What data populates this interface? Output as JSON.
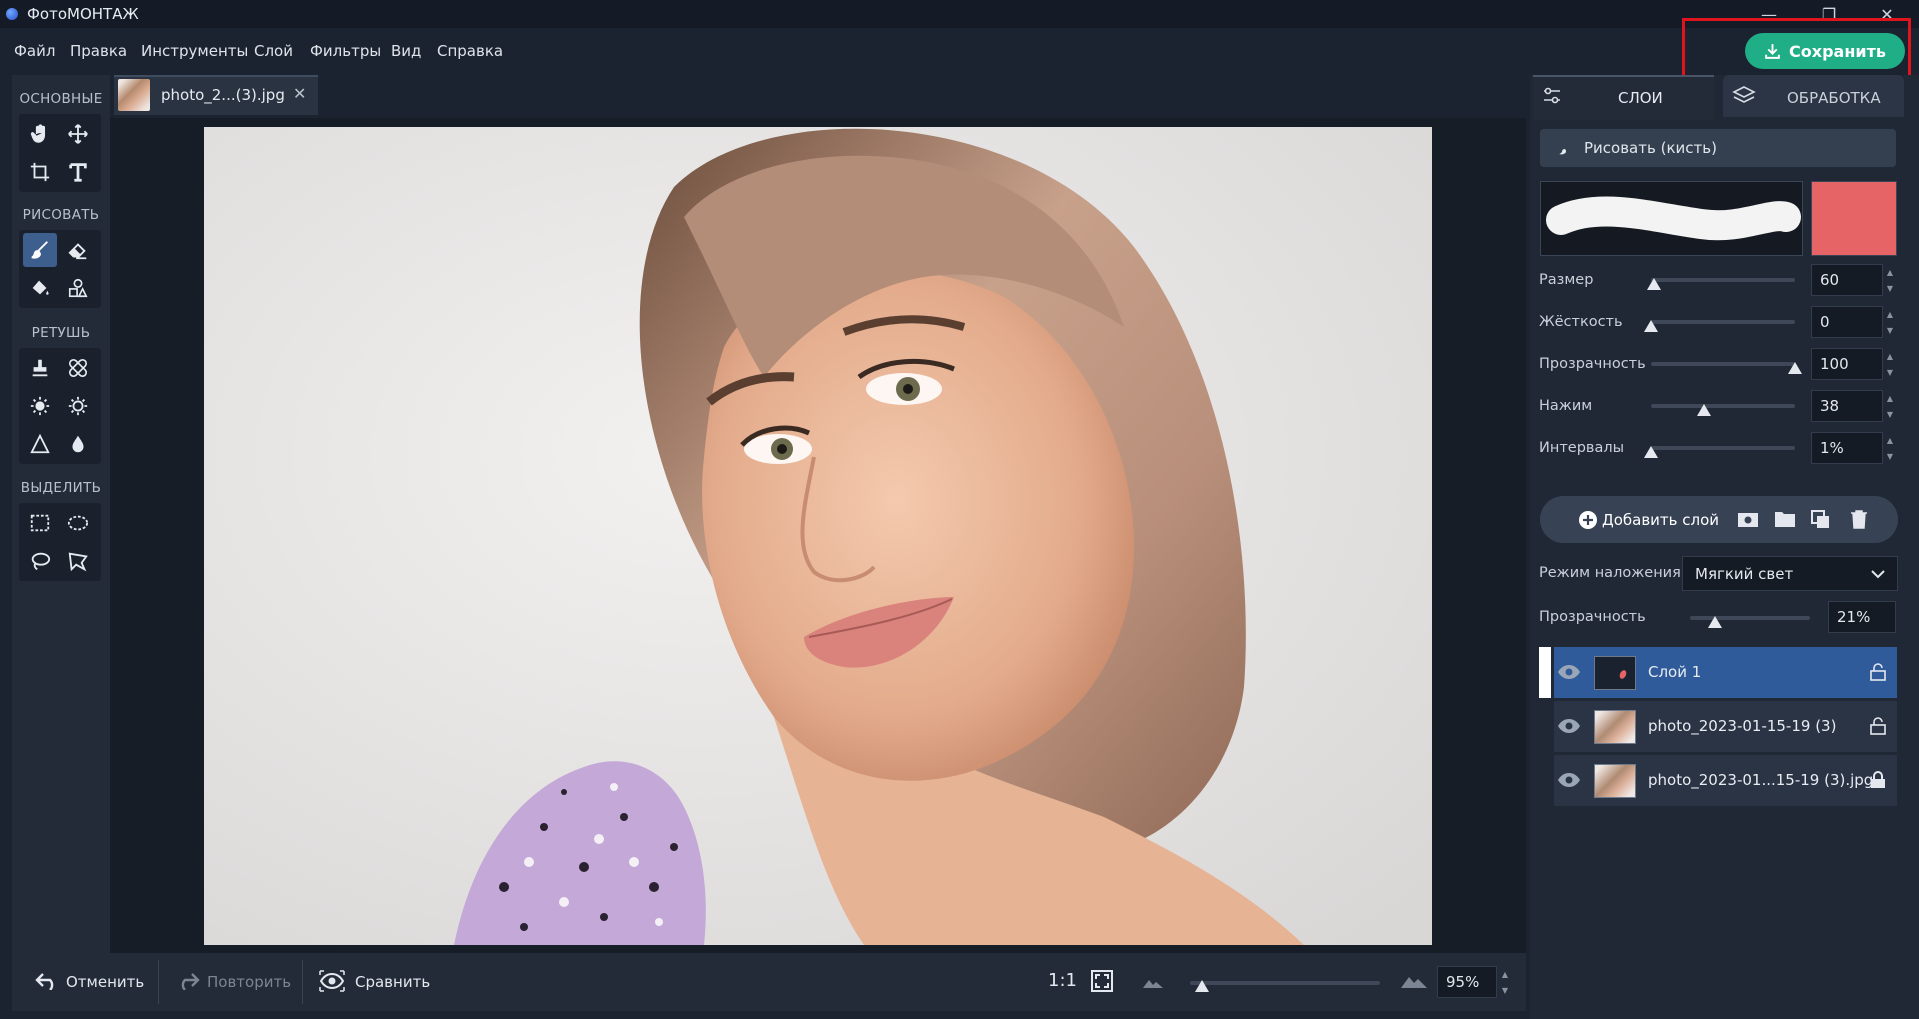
{
  "app": {
    "title": "ФотоМОНТАЖ"
  },
  "menu": [
    "Файл",
    "Правка",
    "Инструменты",
    "Слой",
    "Фильтры",
    "Вид",
    "Справка"
  ],
  "save_button": {
    "label": "Сохранить",
    "icon": "download-icon"
  },
  "highlight": {
    "color": "#e0141c"
  },
  "tools": {
    "sections": [
      "ОСНОВНЫЕ",
      "РИСОВАТЬ",
      "РЕТУШЬ",
      "ВЫДЕЛИТЬ"
    ],
    "active_tool": "brush"
  },
  "document_tab": {
    "label": "photo_2...(3).jpg"
  },
  "bottom_bar": {
    "undo_label": "Отменить",
    "redo_label": "Повторить",
    "compare_label": "Сравнить",
    "ratio_label": "1:1",
    "zoom_value": "95%"
  },
  "right_panel": {
    "tab_layers": "СЛОИ",
    "tab_processing": "ОБРАБОТКА",
    "brush_mode": "Рисовать (кисть)",
    "brush_color": "#e66465",
    "settings": [
      {
        "label": "Размер",
        "value": "60",
        "level": 0.02
      },
      {
        "label": "Жёсткость",
        "value": "0",
        "level": 0.0
      },
      {
        "label": "Прозрачность",
        "value": "100",
        "level": 1.0
      },
      {
        "label": "Нажим",
        "value": "38",
        "level": 0.37
      },
      {
        "label": "Интервалы",
        "value": "1%",
        "level": 0.0
      }
    ],
    "add_layer_label": "Добавить слой",
    "blend_mode_label": "Режим наложения:",
    "blend_mode_value": "Мягкий свет",
    "layer_opacity_label": "Прозрачность",
    "layer_opacity_value": "21%",
    "layer_opacity_level": 0.21,
    "layers": [
      {
        "name": "Слой 1",
        "selected": true,
        "locked": false
      },
      {
        "name": "photo_2023-01-15-19 (3)",
        "selected": false,
        "locked": false
      },
      {
        "name": "photo_2023-01...15-19 (3).jpg",
        "selected": false,
        "locked": true
      }
    ]
  },
  "colors": {
    "accent": "#1fae86",
    "selection": "#2f5b9b"
  }
}
